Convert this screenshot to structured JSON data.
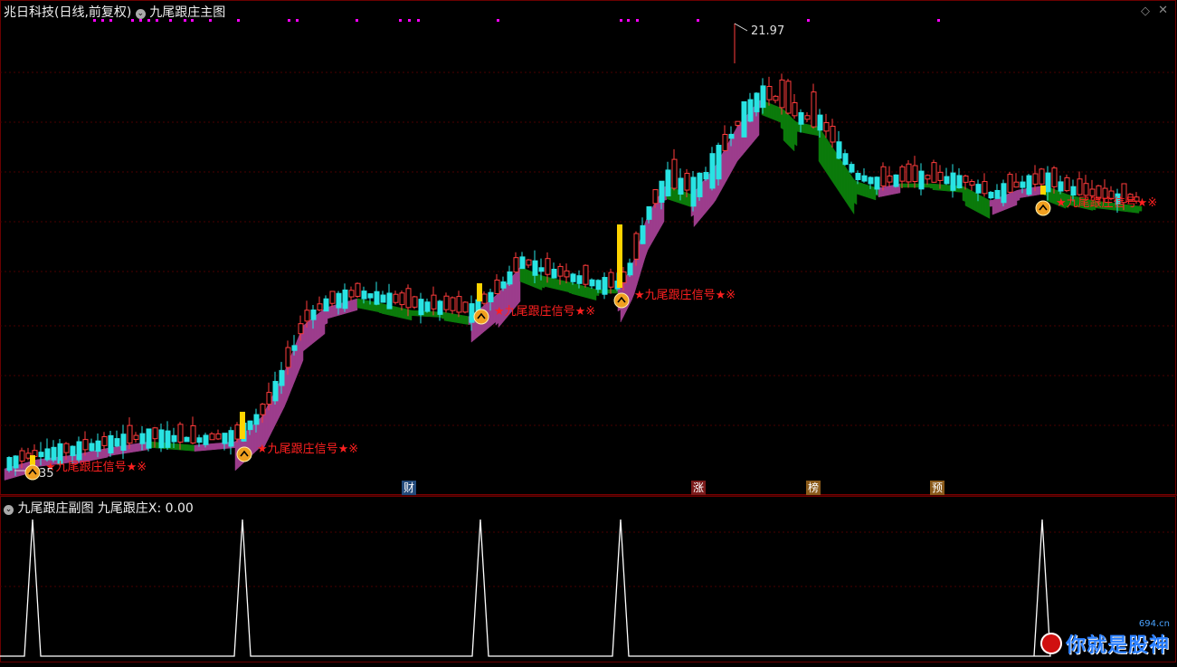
{
  "header": {
    "stock_name": "兆日科技",
    "period_label": "(日线,前复权)",
    "indicator_title": "九尾跟庄主图"
  },
  "sub_header": {
    "indicator_title": "九尾跟庄副图",
    "value_label": "九尾跟庄X: 0.00"
  },
  "price_marks": {
    "high": "21.97",
    "low": "35"
  },
  "signal_label": "★九尾跟庄信号★※",
  "event_badges": [
    "财",
    "涨",
    "榜",
    "预"
  ],
  "watermark": {
    "text": "你就是股神",
    "domain": "694.cn"
  },
  "colors": {
    "up": "#ff3c3c",
    "down": "#29e3e3",
    "ribbon_up": "#9c3d8c",
    "ribbon_down": "#0b7a0b",
    "signal_text": "#ff2020",
    "grid": "#4a0000",
    "dots": "#ff00ff",
    "spike": "#ffffff"
  }
}
